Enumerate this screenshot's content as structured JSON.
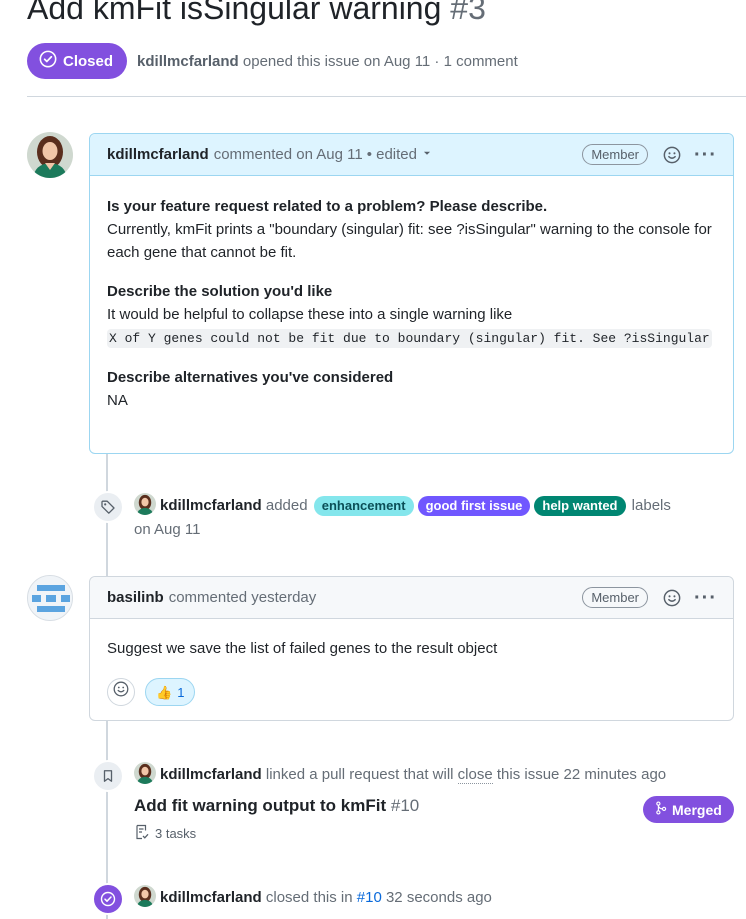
{
  "issue": {
    "title": "Add kmFit isSingular warning",
    "number": "#3",
    "state_label": "Closed",
    "opened_by": "kdillmcfarland",
    "opened_text": "opened this issue on Aug 11 · 1 comment"
  },
  "comment1": {
    "author": "kdillmcfarland",
    "action": "commented on Aug 11",
    "edited": "• edited",
    "role": "Member",
    "heading1": "Is your feature request related to a problem? Please describe.",
    "text1": "Currently, kmFit prints a \"boundary (singular) fit: see ?isSingular\" warning to the console for each gene that cannot be fit.",
    "heading2": "Describe the solution you'd like",
    "text2": "It would be helpful to collapse these into a single warning like",
    "code": "X of Y genes could not be fit due to boundary (singular) fit. See ?isSingular",
    "heading3": "Describe alternatives you've considered",
    "text3": "NA"
  },
  "label_event": {
    "author": "kdillmcfarland",
    "action": "added",
    "labels": [
      {
        "name": "enhancement",
        "bg": "#84e6ec",
        "fg": "#0b4f57"
      },
      {
        "name": "good first issue",
        "bg": "#7057ff",
        "fg": "#ffffff"
      },
      {
        "name": "help wanted",
        "bg": "#008672",
        "fg": "#ffffff"
      }
    ],
    "suffix": "labels",
    "date": "on Aug 11"
  },
  "comment2": {
    "author": "basilinb",
    "action": "commented yesterday",
    "role": "Member",
    "text": "Suggest we save the list of failed genes to the result object",
    "reaction_emoji": "👍",
    "reaction_count": "1"
  },
  "link_event": {
    "author": "kdillmcfarland",
    "text_before": "linked a pull request that will",
    "close_word": "close",
    "text_after": "this issue 22 minutes ago",
    "pr_title": "Add fit warning output to kmFit",
    "pr_number": "#10",
    "tasks": "3 tasks",
    "merged_label": "Merged"
  },
  "close_event": {
    "author": "kdillmcfarland",
    "text": "closed this in",
    "pr_ref": "#10",
    "time": "32 seconds ago"
  },
  "colors": {
    "purple": "#8250df",
    "link": "#0969da"
  }
}
